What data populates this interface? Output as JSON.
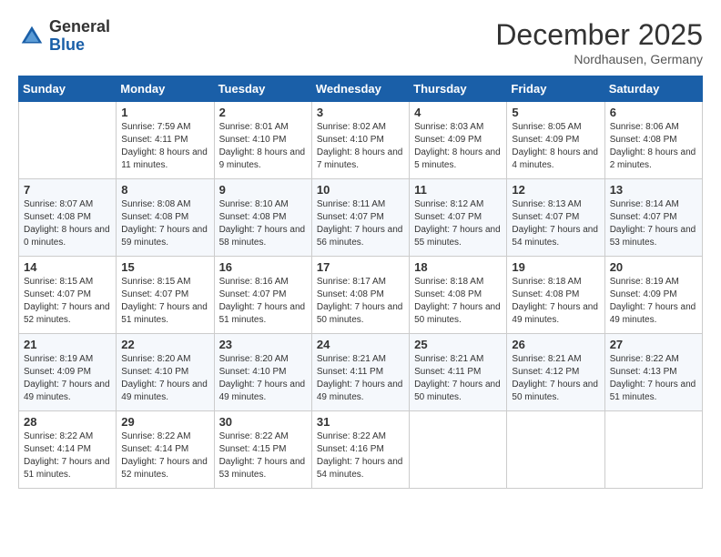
{
  "header": {
    "logo_general": "General",
    "logo_blue": "Blue",
    "month_title": "December 2025",
    "location": "Nordhausen, Germany"
  },
  "days_of_week": [
    "Sunday",
    "Monday",
    "Tuesday",
    "Wednesday",
    "Thursday",
    "Friday",
    "Saturday"
  ],
  "weeks": [
    [
      {
        "day": "",
        "sunrise": "",
        "sunset": "",
        "daylight": ""
      },
      {
        "day": "1",
        "sunrise": "Sunrise: 7:59 AM",
        "sunset": "Sunset: 4:11 PM",
        "daylight": "Daylight: 8 hours and 11 minutes."
      },
      {
        "day": "2",
        "sunrise": "Sunrise: 8:01 AM",
        "sunset": "Sunset: 4:10 PM",
        "daylight": "Daylight: 8 hours and 9 minutes."
      },
      {
        "day": "3",
        "sunrise": "Sunrise: 8:02 AM",
        "sunset": "Sunset: 4:10 PM",
        "daylight": "Daylight: 8 hours and 7 minutes."
      },
      {
        "day": "4",
        "sunrise": "Sunrise: 8:03 AM",
        "sunset": "Sunset: 4:09 PM",
        "daylight": "Daylight: 8 hours and 5 minutes."
      },
      {
        "day": "5",
        "sunrise": "Sunrise: 8:05 AM",
        "sunset": "Sunset: 4:09 PM",
        "daylight": "Daylight: 8 hours and 4 minutes."
      },
      {
        "day": "6",
        "sunrise": "Sunrise: 8:06 AM",
        "sunset": "Sunset: 4:08 PM",
        "daylight": "Daylight: 8 hours and 2 minutes."
      }
    ],
    [
      {
        "day": "7",
        "sunrise": "Sunrise: 8:07 AM",
        "sunset": "Sunset: 4:08 PM",
        "daylight": "Daylight: 8 hours and 0 minutes."
      },
      {
        "day": "8",
        "sunrise": "Sunrise: 8:08 AM",
        "sunset": "Sunset: 4:08 PM",
        "daylight": "Daylight: 7 hours and 59 minutes."
      },
      {
        "day": "9",
        "sunrise": "Sunrise: 8:10 AM",
        "sunset": "Sunset: 4:08 PM",
        "daylight": "Daylight: 7 hours and 58 minutes."
      },
      {
        "day": "10",
        "sunrise": "Sunrise: 8:11 AM",
        "sunset": "Sunset: 4:07 PM",
        "daylight": "Daylight: 7 hours and 56 minutes."
      },
      {
        "day": "11",
        "sunrise": "Sunrise: 8:12 AM",
        "sunset": "Sunset: 4:07 PM",
        "daylight": "Daylight: 7 hours and 55 minutes."
      },
      {
        "day": "12",
        "sunrise": "Sunrise: 8:13 AM",
        "sunset": "Sunset: 4:07 PM",
        "daylight": "Daylight: 7 hours and 54 minutes."
      },
      {
        "day": "13",
        "sunrise": "Sunrise: 8:14 AM",
        "sunset": "Sunset: 4:07 PM",
        "daylight": "Daylight: 7 hours and 53 minutes."
      }
    ],
    [
      {
        "day": "14",
        "sunrise": "Sunrise: 8:15 AM",
        "sunset": "Sunset: 4:07 PM",
        "daylight": "Daylight: 7 hours and 52 minutes."
      },
      {
        "day": "15",
        "sunrise": "Sunrise: 8:15 AM",
        "sunset": "Sunset: 4:07 PM",
        "daylight": "Daylight: 7 hours and 51 minutes."
      },
      {
        "day": "16",
        "sunrise": "Sunrise: 8:16 AM",
        "sunset": "Sunset: 4:07 PM",
        "daylight": "Daylight: 7 hours and 51 minutes."
      },
      {
        "day": "17",
        "sunrise": "Sunrise: 8:17 AM",
        "sunset": "Sunset: 4:08 PM",
        "daylight": "Daylight: 7 hours and 50 minutes."
      },
      {
        "day": "18",
        "sunrise": "Sunrise: 8:18 AM",
        "sunset": "Sunset: 4:08 PM",
        "daylight": "Daylight: 7 hours and 50 minutes."
      },
      {
        "day": "19",
        "sunrise": "Sunrise: 8:18 AM",
        "sunset": "Sunset: 4:08 PM",
        "daylight": "Daylight: 7 hours and 49 minutes."
      },
      {
        "day": "20",
        "sunrise": "Sunrise: 8:19 AM",
        "sunset": "Sunset: 4:09 PM",
        "daylight": "Daylight: 7 hours and 49 minutes."
      }
    ],
    [
      {
        "day": "21",
        "sunrise": "Sunrise: 8:19 AM",
        "sunset": "Sunset: 4:09 PM",
        "daylight": "Daylight: 7 hours and 49 minutes."
      },
      {
        "day": "22",
        "sunrise": "Sunrise: 8:20 AM",
        "sunset": "Sunset: 4:10 PM",
        "daylight": "Daylight: 7 hours and 49 minutes."
      },
      {
        "day": "23",
        "sunrise": "Sunrise: 8:20 AM",
        "sunset": "Sunset: 4:10 PM",
        "daylight": "Daylight: 7 hours and 49 minutes."
      },
      {
        "day": "24",
        "sunrise": "Sunrise: 8:21 AM",
        "sunset": "Sunset: 4:11 PM",
        "daylight": "Daylight: 7 hours and 49 minutes."
      },
      {
        "day": "25",
        "sunrise": "Sunrise: 8:21 AM",
        "sunset": "Sunset: 4:11 PM",
        "daylight": "Daylight: 7 hours and 50 minutes."
      },
      {
        "day": "26",
        "sunrise": "Sunrise: 8:21 AM",
        "sunset": "Sunset: 4:12 PM",
        "daylight": "Daylight: 7 hours and 50 minutes."
      },
      {
        "day": "27",
        "sunrise": "Sunrise: 8:22 AM",
        "sunset": "Sunset: 4:13 PM",
        "daylight": "Daylight: 7 hours and 51 minutes."
      }
    ],
    [
      {
        "day": "28",
        "sunrise": "Sunrise: 8:22 AM",
        "sunset": "Sunset: 4:14 PM",
        "daylight": "Daylight: 7 hours and 51 minutes."
      },
      {
        "day": "29",
        "sunrise": "Sunrise: 8:22 AM",
        "sunset": "Sunset: 4:14 PM",
        "daylight": "Daylight: 7 hours and 52 minutes."
      },
      {
        "day": "30",
        "sunrise": "Sunrise: 8:22 AM",
        "sunset": "Sunset: 4:15 PM",
        "daylight": "Daylight: 7 hours and 53 minutes."
      },
      {
        "day": "31",
        "sunrise": "Sunrise: 8:22 AM",
        "sunset": "Sunset: 4:16 PM",
        "daylight": "Daylight: 7 hours and 54 minutes."
      },
      {
        "day": "",
        "sunrise": "",
        "sunset": "",
        "daylight": ""
      },
      {
        "day": "",
        "sunrise": "",
        "sunset": "",
        "daylight": ""
      },
      {
        "day": "",
        "sunrise": "",
        "sunset": "",
        "daylight": ""
      }
    ]
  ]
}
